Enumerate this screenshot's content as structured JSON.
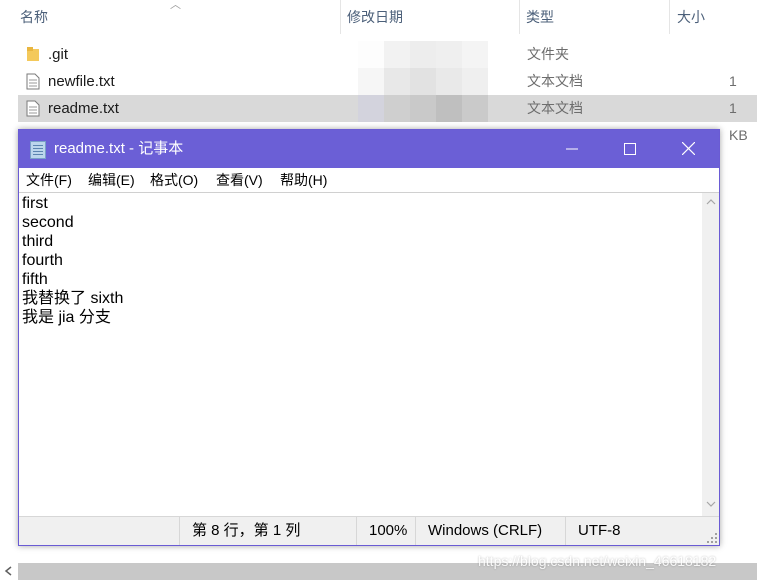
{
  "explorer": {
    "columns": {
      "name": "名称",
      "modified": "修改日期",
      "type": "类型",
      "size": "大小"
    },
    "files": [
      {
        "name": ".git",
        "type": "文件夹",
        "size": "",
        "icon": "folder-icon"
      },
      {
        "name": "newfile.txt",
        "type": "文本文档",
        "size": "1 KB",
        "icon": "text-file-icon"
      },
      {
        "name": "readme.txt",
        "type": "文本文档",
        "size": "1 KB",
        "icon": "text-file-icon",
        "selected": true
      }
    ]
  },
  "notepad": {
    "title": "readme.txt - 记事本",
    "controls": {
      "minimize": "—",
      "maximize": "☐",
      "close": "✕"
    },
    "menu": {
      "file": "文件(F)",
      "edit": "编辑(E)",
      "format": "格式(O)",
      "view": "查看(V)",
      "help": "帮助(H)"
    },
    "content": [
      "first",
      "second",
      "third",
      "fourth",
      "fifth",
      "我替换了 sixth",
      "我是 jia 分支"
    ],
    "status": {
      "position": "第 8 行，第 1 列",
      "zoom": "100%",
      "line_ending": "Windows (CRLF)",
      "encoding": "UTF-8"
    },
    "colors": {
      "titlebar": "#6b5fd6",
      "accent_border": "#6a5bd4"
    }
  },
  "watermark": "https://blog.csdn.net/weixin_46618182"
}
